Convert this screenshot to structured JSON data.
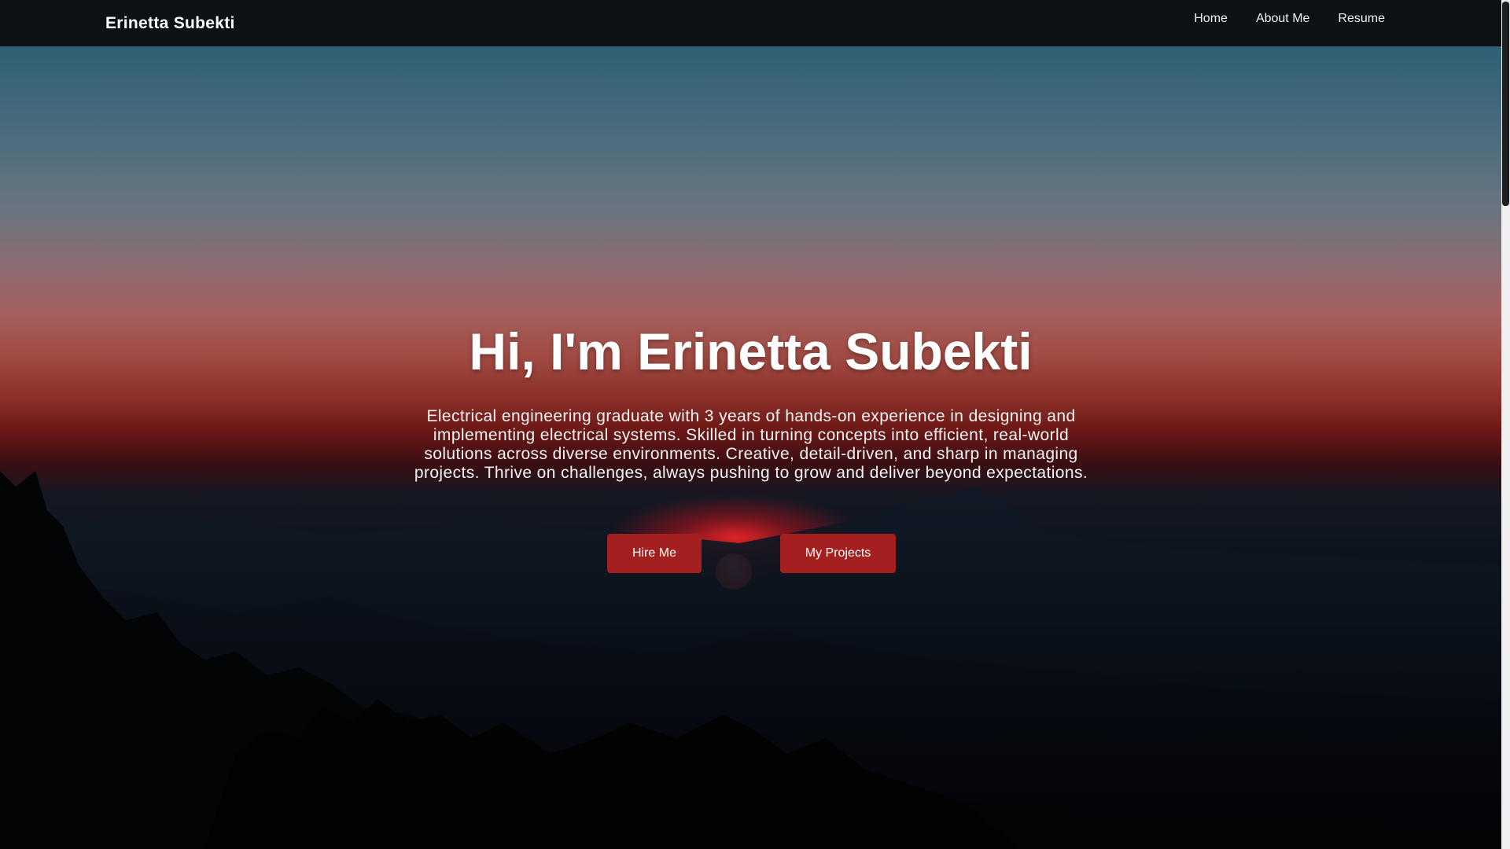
{
  "navbar": {
    "brand": "Erinetta Subekti",
    "links": [
      {
        "label": "Home"
      },
      {
        "label": "About Me"
      },
      {
        "label": "Resume"
      }
    ]
  },
  "hero": {
    "title": "Hi, I'm Erinetta Subekti",
    "description": "Electrical engineering graduate with 3 years of hands-on experience in designing and implementing electrical systems. Skilled in turning concepts into efficient, real-world solutions across diverse environments. Creative, detail-driven, and sharp in managing projects. Thrive on challenges, always pushing to grow and deliver beyond expectations.",
    "buttons": {
      "hire": "Hire Me",
      "projects": "My Projects"
    },
    "background": "sunset-over-mountains"
  },
  "colors": {
    "navbar_bg": "#0b1114",
    "button_bg": "#a3201e",
    "text": "#ffffff"
  }
}
